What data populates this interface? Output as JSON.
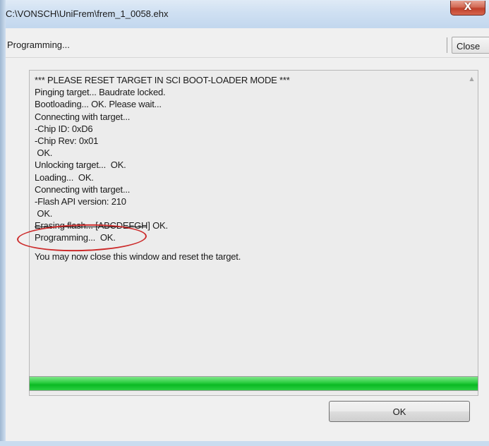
{
  "window": {
    "title": "C:\\VONSCH\\UniFrem\\frem_1_0058.ehx",
    "close_glyph": "X"
  },
  "toolbar": {
    "status_label": "Programming...",
    "close_label": "Close"
  },
  "log": {
    "lines": [
      "*** PLEASE RESET TARGET IN SCI BOOT-LOADER MODE ***",
      "Pinging target... Baudrate locked.",
      "Bootloading... OK. Please wait...",
      "Connecting with target...",
      "-Chip ID: 0xD6",
      "-Chip Rev: 0x01",
      " OK.",
      "Unlocking target...  OK.",
      "Loading...  OK.",
      "Connecting with target...",
      "-Flash API version: 210",
      " OK.",
      "Erasing flash... [ABCDEFGH] OK.",
      "Programming...  OK.",
      "You may now close this window and reset the target."
    ],
    "scroll_up_glyph": "▲",
    "scroll_down_glyph": "▼"
  },
  "progress": {
    "value_percent": 100,
    "color": "#0aba23"
  },
  "buttons": {
    "ok_label": "OK"
  },
  "annotation": {
    "highlight_color": "#cc2a2a",
    "highlighted_line": "Programming...  OK."
  }
}
